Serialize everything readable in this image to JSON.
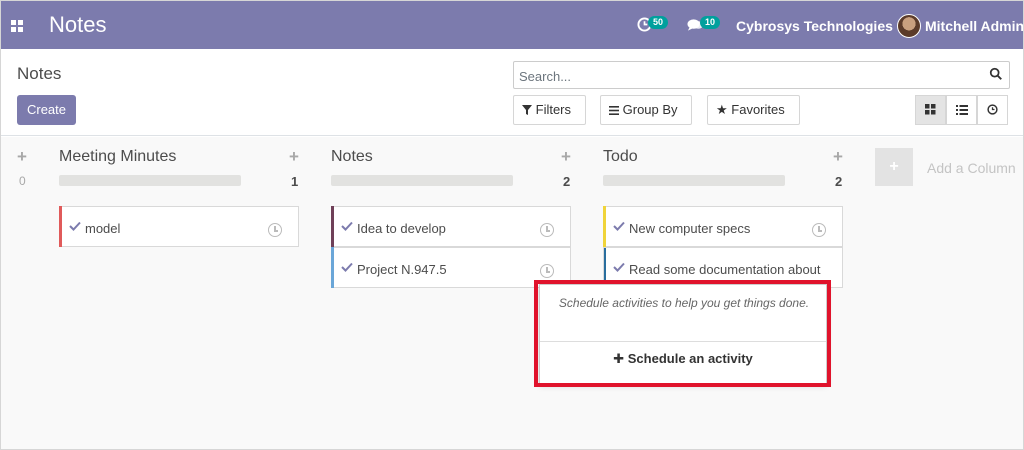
{
  "navbar": {
    "app_title": "Notes",
    "activity_count": "50",
    "message_count": "10",
    "company": "Cybrosys Technologies",
    "user": "Mitchell Admin",
    "bg_color": "#7c7bad"
  },
  "control_panel": {
    "breadcrumb": "Notes",
    "create_label": "Create",
    "search_placeholder": "Search...",
    "filters_label": "Filters",
    "group_by_label": "Group By",
    "favorites_label": "Favorites",
    "views": [
      "kanban-view-icon",
      "list-view-icon",
      "activity-view-icon"
    ]
  },
  "columns": [
    {
      "title": "Meeting Minutes",
      "zero": "0",
      "count": "1",
      "cards": [
        {
          "label": "model",
          "color": "#e05a5a"
        }
      ]
    },
    {
      "title": "Notes",
      "count": "2",
      "cards": [
        {
          "label": "Idea to develop",
          "color": "#6f4058"
        },
        {
          "label": "Project N.947.5",
          "color": "#6aa6d8"
        }
      ]
    },
    {
      "title": "Todo",
      "count": "2",
      "cards": [
        {
          "label": "New computer specs",
          "color": "#f0d43a"
        },
        {
          "label": "Read some documentation about",
          "color": "#2a6e9e"
        }
      ]
    }
  ],
  "add_column": {
    "label": "Add a Column"
  },
  "popover": {
    "help_text": "Schedule activities to help you get things done.",
    "button_label": "Schedule an activity",
    "highlight_color": "#e0132c"
  }
}
